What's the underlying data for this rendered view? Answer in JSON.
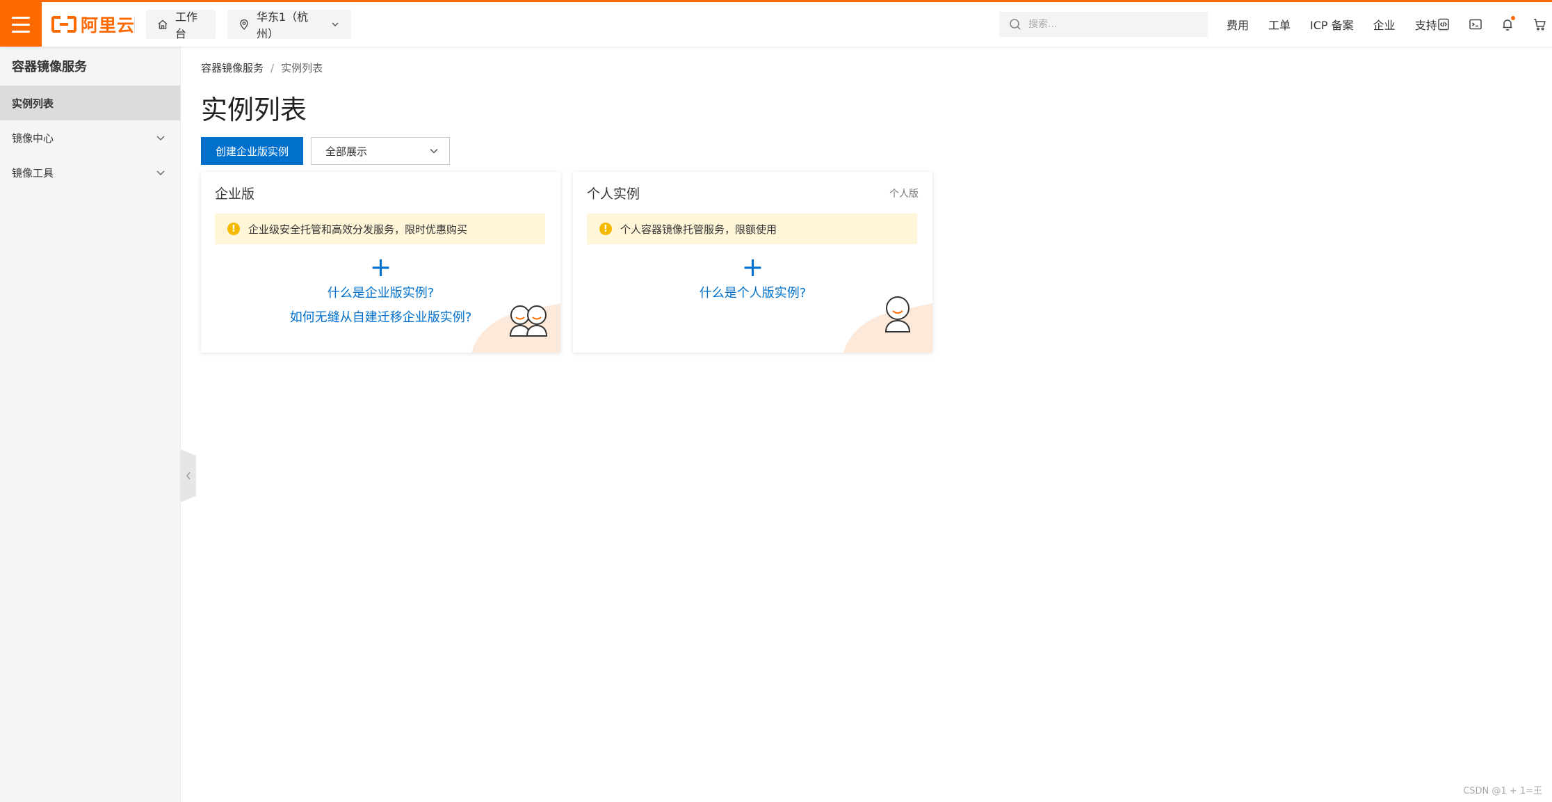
{
  "brand": {
    "logo_text": "阿里云",
    "accent": "#ff6a00",
    "link_color": "#0070cc"
  },
  "topbar": {
    "workbench": "工作台",
    "region": "华东1（杭州）",
    "search_placeholder": "搜索...",
    "links": [
      "费用",
      "工单",
      "ICP 备案",
      "企业",
      "支持"
    ],
    "icons": [
      "code-icon",
      "terminal-icon",
      "bell-icon",
      "cart-icon"
    ]
  },
  "sidebar": {
    "title": "容器镜像服务",
    "items": [
      {
        "label": "实例列表",
        "active": true
      },
      {
        "label": "镜像中心",
        "expandable": true
      },
      {
        "label": "镜像工具",
        "expandable": true
      }
    ]
  },
  "main": {
    "breadcrumb": [
      "容器镜像服务",
      "实例列表"
    ],
    "breadcrumb_sep": "/",
    "title": "实例列表",
    "create_button": "创建企业版实例",
    "filter_value": "全部展示",
    "cards": {
      "enterprise": {
        "title": "企业版",
        "notice": "企业级安全托管和高效分发服务，限时优惠购买",
        "links": [
          "什么是企业版实例?",
          "如何无缝从自建迁移企业版实例?"
        ]
      },
      "personal": {
        "title": "个人实例",
        "tag": "个人版",
        "notice": "个人容器镜像托管服务，限额使用",
        "links": [
          "什么是个人版实例?"
        ]
      }
    }
  },
  "watermark": "CSDN @1 + 1=王"
}
